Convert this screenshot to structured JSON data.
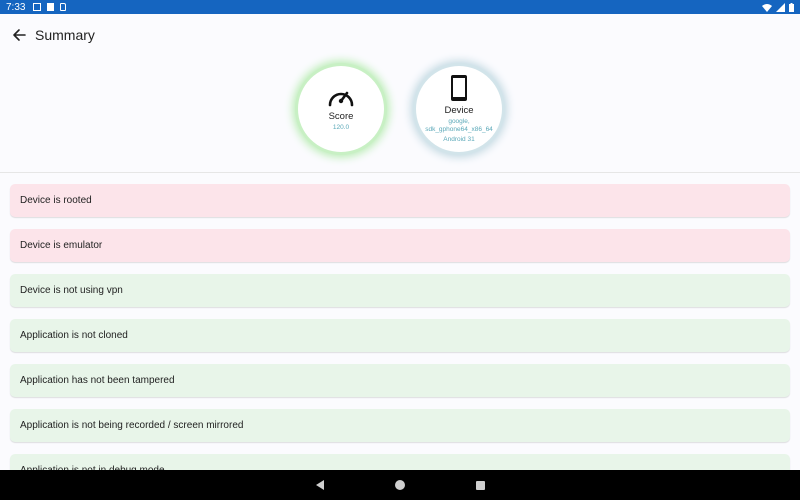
{
  "status_bar": {
    "time": "7:33",
    "icons": [
      "notification-icon",
      "doc-icon",
      "sd-card-icon",
      "wifi-icon",
      "signal-icon",
      "battery-icon"
    ]
  },
  "toolbar": {
    "title": "Summary",
    "back_icon": "arrow-back-icon"
  },
  "score": {
    "label": "Score",
    "value": "120.0",
    "icon": "speedometer-icon",
    "glow_color": "#b6ecb0"
  },
  "device": {
    "label": "Device",
    "model": "google, sdk_gphone64_x86_64",
    "os": "Android 31",
    "icon": "phone-icon",
    "glow_color": "#bfd7e0"
  },
  "checks": [
    {
      "text": "Device is rooted",
      "status": "bad"
    },
    {
      "text": "Device is emulator",
      "status": "bad"
    },
    {
      "text": "Device is not using vpn",
      "status": "good"
    },
    {
      "text": "Application is not cloned",
      "status": "good"
    },
    {
      "text": "Application has not been tampered",
      "status": "good"
    },
    {
      "text": "Application is not being recorded / screen mirrored",
      "status": "good"
    },
    {
      "text": "Application is not in debug mode",
      "status": "good"
    }
  ],
  "colors": {
    "status_bar": "#1565c0",
    "bad_bg": "#fce4ea",
    "good_bg": "#e8f5e9"
  }
}
